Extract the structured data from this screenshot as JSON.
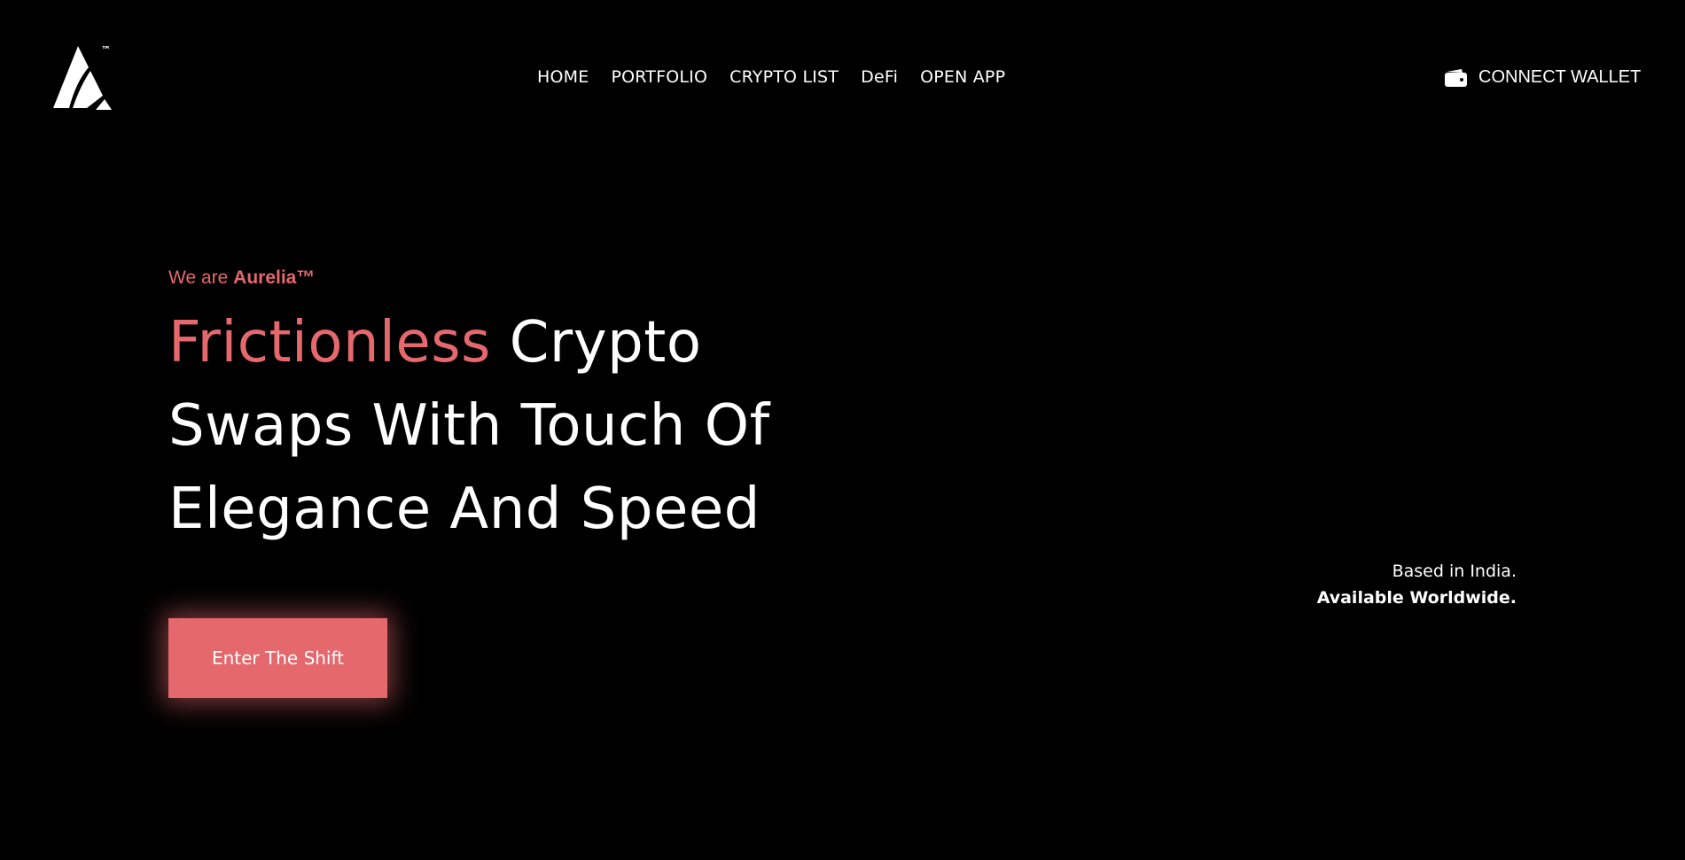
{
  "header": {
    "nav": [
      {
        "label": "HOME"
      },
      {
        "label": "PORTFOLIO"
      },
      {
        "label": "CRYPTO LIST"
      },
      {
        "label": "DeFi"
      },
      {
        "label": "OPEN APP"
      }
    ],
    "connect_label": "CONNECT WALLET",
    "logo_mark": "™"
  },
  "hero": {
    "eyebrow_prefix": "We are ",
    "eyebrow_brand": "Aurelia™",
    "headline_accent": "Frictionless",
    "headline_line1_rest": " Crypto",
    "headline_line2": "Swaps With Touch Of",
    "headline_line3": "Elegance And Speed",
    "cta_label": "Enter The Shift"
  },
  "location": {
    "line1": "Based in India.",
    "line2": "Available Worldwide."
  },
  "colors": {
    "accent": "#e5686c",
    "background": "#000000",
    "text": "#ffffff"
  }
}
